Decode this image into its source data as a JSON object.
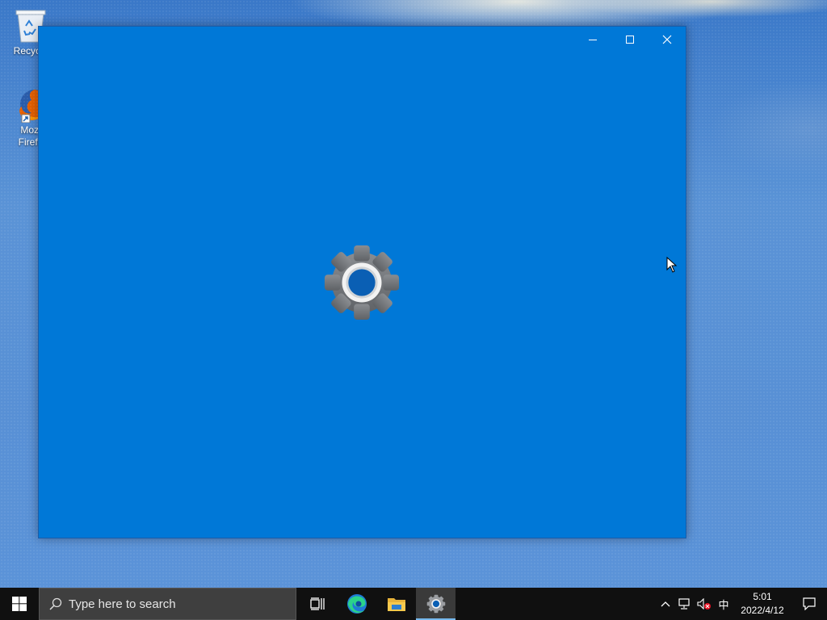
{
  "desktop": {
    "icons": [
      {
        "label": "Recycle",
        "icon": "recycle-bin-icon"
      },
      {
        "label": "Mozilla\nFirefox",
        "label_line1": "Mozi",
        "label_line2": "Firefo",
        "icon": "firefox-icon"
      }
    ]
  },
  "window": {
    "controls": [
      "minimize-icon",
      "maximize-icon",
      "close-icon"
    ],
    "splash_icon": "gear-icon",
    "background_color": "#0078d7"
  },
  "taskbar": {
    "search": {
      "placeholder": "Type here to search",
      "icon": "search-icon"
    },
    "apps": [
      {
        "name": "task-view",
        "icon": "task-view-icon",
        "active": false
      },
      {
        "name": "edge",
        "icon": "edge-icon",
        "active": false
      },
      {
        "name": "file-explorer",
        "icon": "folder-icon",
        "active": false
      },
      {
        "name": "settings",
        "icon": "gear-icon",
        "active": true
      }
    ],
    "tray": {
      "show_hidden_icon": "chevron-up-icon",
      "network_icon": "network-icon",
      "volume_icon": "volume-muted-icon",
      "ime_label": "中",
      "time": "5:01",
      "date": "2022/4/12",
      "notification_icon": "notification-icon"
    }
  },
  "colors": {
    "accent": "#0078d7",
    "taskbar": "#101010",
    "active_indicator": "#76b9ed"
  }
}
